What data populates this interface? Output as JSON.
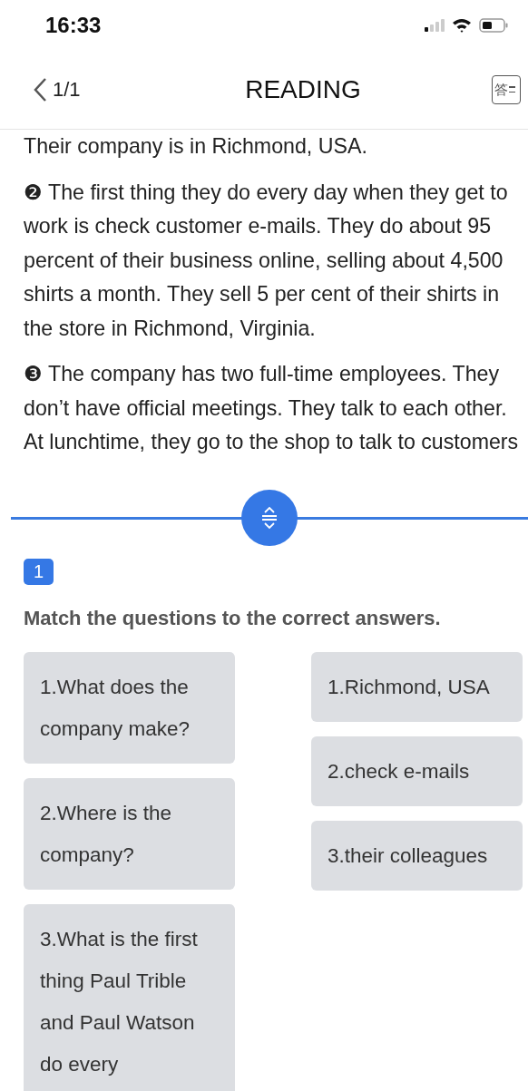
{
  "status_bar": {
    "time": "16:33"
  },
  "header": {
    "back_label": "1/1",
    "title": "READING",
    "answer_button": "答"
  },
  "passage": {
    "paragraphs": [
      "Their company is in Richmond, USA.",
      "❷ The first thing they do every day when they get to work is check customer e-mails. They do about 95 percent of their business online, selling about 4,500 shirts a month. They sell 5 per cent of their shirts in the store in Richmond, Virginia.",
      "❸ The company has two full-time employees. They don’t have official meetings. They talk to each other. At lunchtime, they go to the shop to talk to customers"
    ]
  },
  "question": {
    "number": "1",
    "instruction": "Match the questions to the correct answers.",
    "questions": [
      "1.What does the company make?",
      "2.Where is the company?",
      "3.What is the first thing Paul Trible and Paul Watson do every"
    ],
    "answers": [
      "1.Richmond, USA",
      "2.check e-mails",
      "3.their colleagues"
    ]
  }
}
